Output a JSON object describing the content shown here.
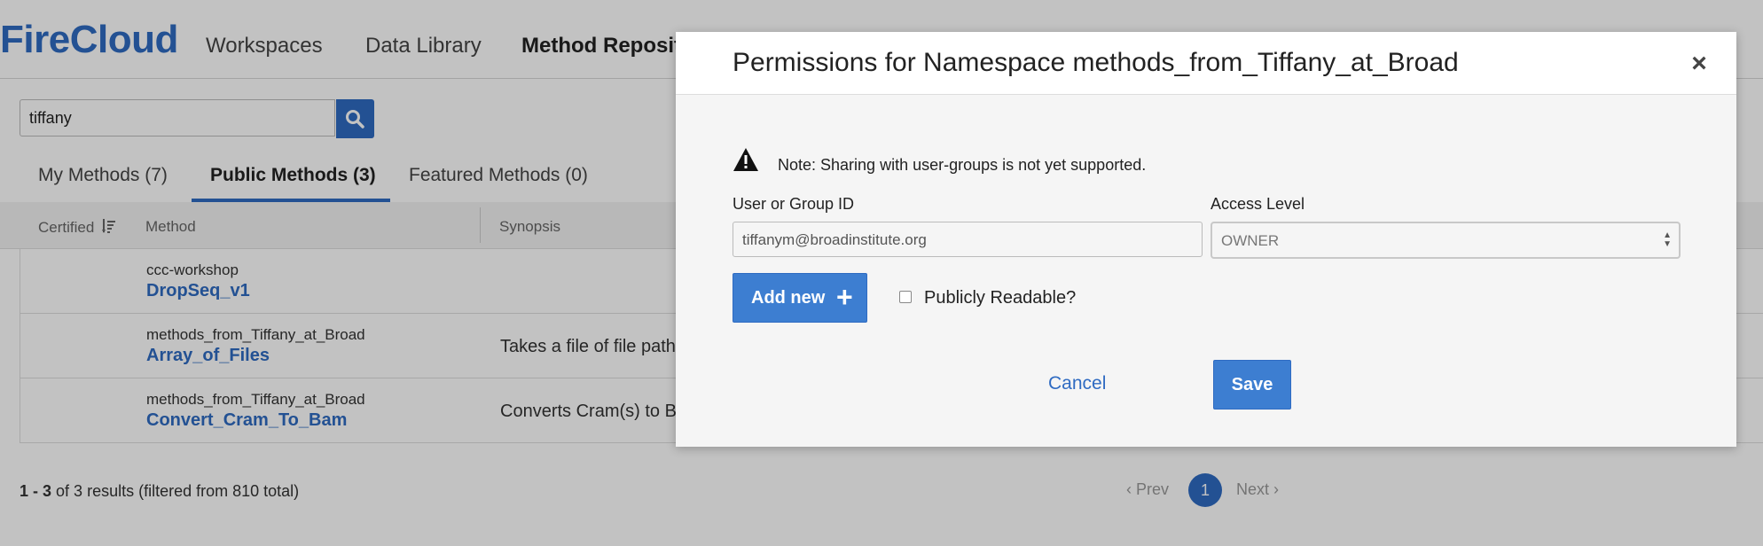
{
  "app": {
    "logo": "FireCloud",
    "nav": [
      "Workspaces",
      "Data Library",
      "Method Reposito"
    ],
    "search": {
      "value": "tiffany"
    },
    "tabs": [
      "My Methods (7)",
      "Public Methods (3)",
      "Featured Methods (0)"
    ],
    "columns": {
      "certified": "Certified",
      "method": "Method",
      "synopsis": "Synopsis"
    },
    "rows": [
      {
        "namespace": "ccc-workshop",
        "name": "DropSeq_v1",
        "synopsis": ""
      },
      {
        "namespace": "methods_from_Tiffany_at_Broad",
        "name": "Array_of_Files",
        "synopsis": "Takes a file of file path"
      },
      {
        "namespace": "methods_from_Tiffany_at_Broad",
        "name": "Convert_Cram_To_Bam",
        "synopsis": "Converts Cram(s) to B"
      }
    ],
    "results": {
      "range": "1 - 3",
      "rest": "of 3 results (filtered from 810 total)"
    },
    "pager": {
      "prev": "Prev",
      "page": "1",
      "next": "Next"
    }
  },
  "modal": {
    "title": "Permissions for Namespace methods_from_Tiffany_at_Broad",
    "note": "Note: Sharing with user-groups is not yet supported.",
    "user_label": "User or Group ID",
    "user_value": "tiffanym@broadinstitute.org",
    "access_label": "Access Level",
    "access_value": "OWNER",
    "add_new": "Add new",
    "public_label": "Publicly Readable?",
    "public_checked": false,
    "cancel": "Cancel",
    "save": "Save"
  },
  "colors": {
    "accent": "#2f6bc2",
    "button": "#3d7ed1"
  }
}
